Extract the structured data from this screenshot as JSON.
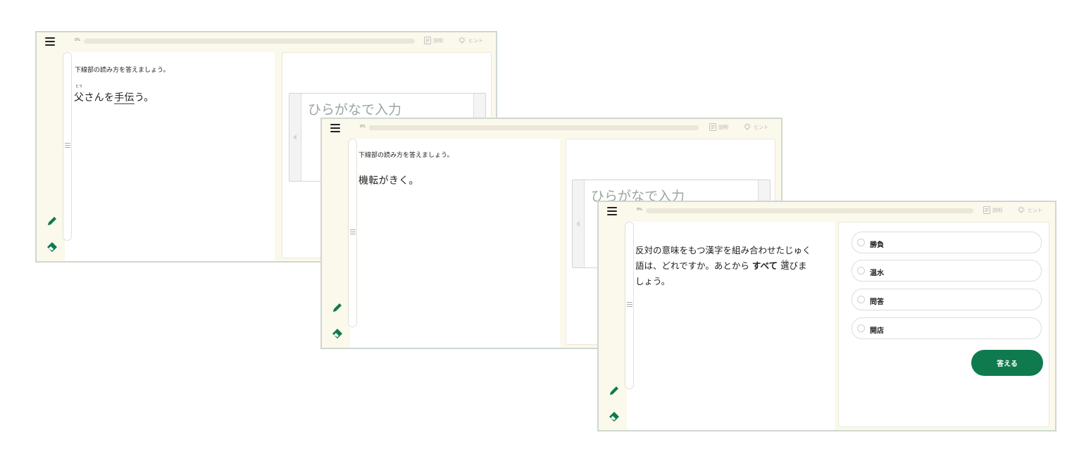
{
  "topbar": {
    "progress_text": "0%",
    "progress_value": 0,
    "explanation_label": "説明",
    "hint_label": "ヒント"
  },
  "icons": {
    "menu": "hamburger-menu-icon",
    "explanation": "document-icon",
    "hint": "lightbulb-icon",
    "pencil": "pencil-icon",
    "eraser": "eraser-icon",
    "grip": "drag-handle-icon"
  },
  "colors": {
    "accent": "#0f7a4e",
    "frame_bg": "#fbf8ec",
    "frame_border": "#cfd8cf",
    "progress_track": "#ebe7d8"
  },
  "screen1": {
    "instruction": "下線部の読み方を答えましょう。",
    "question": {
      "before": "父",
      "ruby_base": "父",
      "ruby": "とう",
      "middle": "さんを",
      "underlined": "手伝",
      "after": "う。"
    },
    "input_placeholder": "ひらがなで入力"
  },
  "screen2": {
    "instruction": "下線部の読み方を答えましょう。",
    "question": "機転がきく。",
    "input_placeholder": "ひらがなで入力"
  },
  "screen3": {
    "question": {
      "line1": "反対の意味をもつ漢字を組み合わせたじゅく",
      "line2_before": "語は、どれですか。あとから",
      "line2_bold": "すべて",
      "line2_ruby_base": "選",
      "line2_ruby": "えら",
      "line2_after": "びま",
      "line3": "しょう。"
    },
    "choices": [
      "勝負",
      "温水",
      "問答",
      "開店"
    ],
    "submit_label": "答える"
  }
}
